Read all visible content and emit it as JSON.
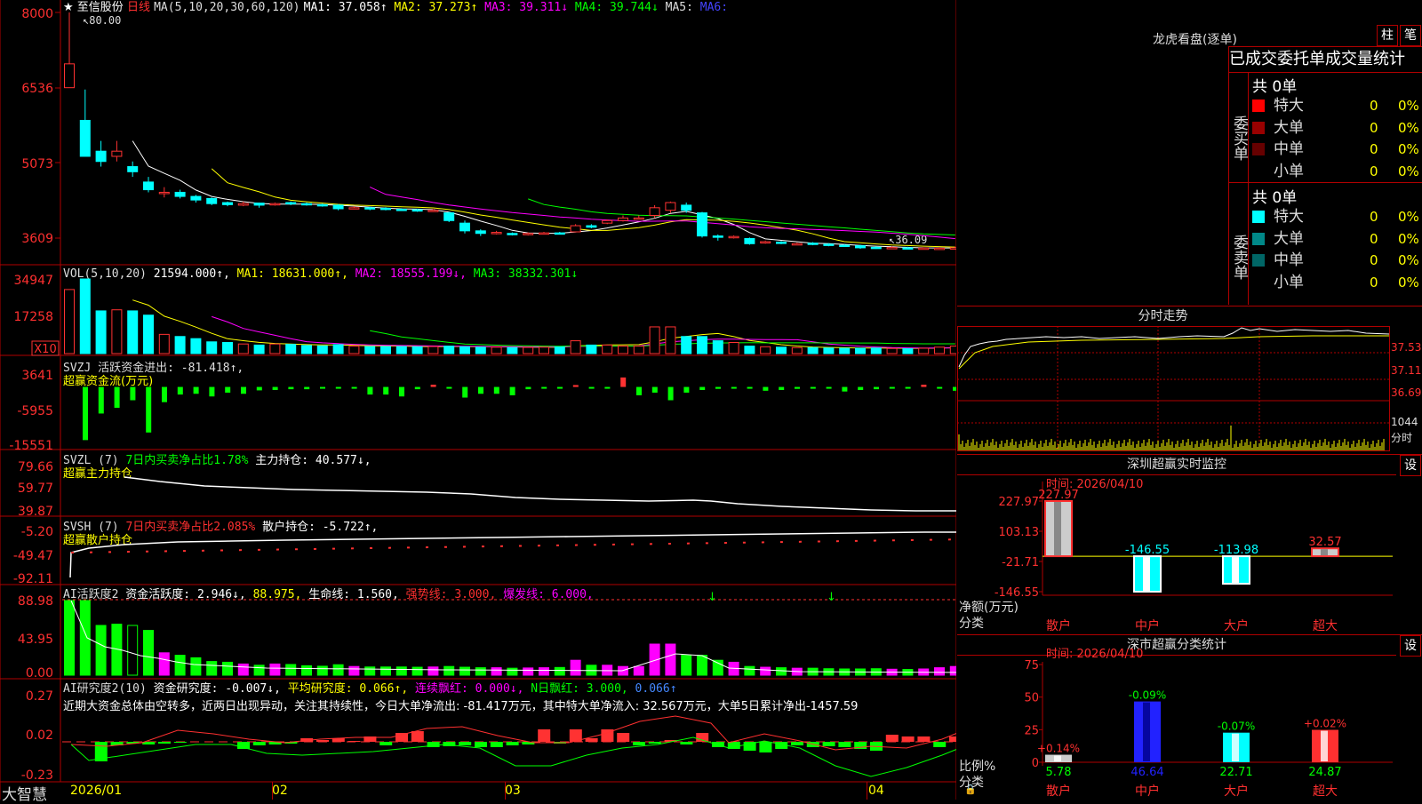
{
  "app_name": "大智慧",
  "stock": {
    "name": "至信股份",
    "period": "日线"
  },
  "ma_line": {
    "label": "MA(5,10,20,30,60,120)",
    "items": [
      {
        "text": "MA1: 37.058↑",
        "color": "#ffffff"
      },
      {
        "text": "MA2: 37.273↑",
        "color": "#ffff00"
      },
      {
        "text": "MA3: 39.311↓",
        "color": "#ff00ff"
      },
      {
        "text": "MA4: 39.744↓",
        "color": "#00ff00"
      },
      {
        "text": "MA5: ",
        "color": "#dddddd"
      },
      {
        "text": "MA6:",
        "color": "#4444ff"
      }
    ]
  },
  "price_axis": [
    "8000",
    "6536",
    "5073",
    "3609"
  ],
  "price_marks": {
    "high": "80.00",
    "low": "36.09"
  },
  "vol": {
    "axis": [
      "34947",
      "17258"
    ],
    "unit": "X10",
    "items": [
      {
        "text": "VOL(5,10,20)",
        "color": "#dddddd"
      },
      {
        "text": "21594.000↑,",
        "color": "#ffffff"
      },
      {
        "text": "MA1: 18631.000↑,",
        "color": "#ffff00"
      },
      {
        "text": "MA2: 18555.199↓,",
        "color": "#ff00ff"
      },
      {
        "text": "MA3: 38332.301↓",
        "color": "#00ff00"
      }
    ]
  },
  "svzj": {
    "axis": [
      "3641",
      "-5955",
      "-15551"
    ],
    "line1": "SVZJ  活跃资金进出: -81.418↑,",
    "line2": "超赢资金流(万元)"
  },
  "svzl": {
    "axis": [
      "79.66",
      "59.77",
      "39.87"
    ],
    "p1": "SVZL (7)",
    "p2": "7日内买卖净占比1.78%",
    "p3": "主力持仓: 40.577↓,",
    "line2": "超赢主力持仓"
  },
  "svsh": {
    "axis": [
      "-5.20",
      "-49.47",
      "-92.11"
    ],
    "p1": "SVSH (7)",
    "p2": "7日内买卖净占比2.085%",
    "p3": "散户持仓: -5.722↑,",
    "line2": "超赢散户持仓"
  },
  "ai1": {
    "axis": [
      "88.98",
      "43.95",
      "0.00"
    ],
    "items": [
      {
        "text": "AI活跃度2",
        "color": "#dddddd"
      },
      {
        "text": "资金活跃度: 2.946↓,",
        "color": "#ffffff"
      },
      {
        "text": "88.975,",
        "color": "#ffff00"
      },
      {
        "text": "生命线: 1.560,",
        "color": "#ffffff"
      },
      {
        "text": "强势线: 3.000,",
        "color": "#ff3030"
      },
      {
        "text": "爆发线: 6.000,",
        "color": "#ff00ff"
      }
    ]
  },
  "ai2": {
    "axis": [
      "0.27",
      "0.02",
      "-0.23"
    ],
    "items": [
      {
        "text": "AI研究度2(10)",
        "color": "#dddddd"
      },
      {
        "text": "资金研究度: -0.007↓,",
        "color": "#ffffff"
      },
      {
        "text": "平均研究度: 0.066↑,",
        "color": "#ffff00"
      },
      {
        "text": "连续飘红: 0.000↓,",
        "color": "#ff00ff"
      },
      {
        "text": "N日飘红: 3.000,",
        "color": "#00ff00"
      },
      {
        "text": "0.066↑",
        "color": "#4488ff"
      }
    ],
    "note": "近期大资金总体由空转多，近两日出现异动，关注其持续性，今日大单净流出: -81.417万元，其中特大单净流入: 32.567万元，大单5日累计净出-1457.59"
  },
  "date_axis": [
    "2026/01",
    "02",
    "03",
    "04"
  ],
  "right": {
    "lhkp_title": "龙虎看盘(逐单)",
    "btn_zhu": "柱",
    "btn_bi": "笔",
    "table_header": "已成交委托单成交量统计",
    "buy": {
      "side_label": "委买单",
      "total": "共 0单",
      "rows": [
        {
          "name": "特大",
          "count": "0",
          "pct": "0%",
          "color": "#ff0000"
        },
        {
          "name": "大单",
          "count": "0",
          "pct": "0%",
          "color": "#990000"
        },
        {
          "name": "中单",
          "count": "0",
          "pct": "0%",
          "color": "#660000"
        },
        {
          "name": "小单",
          "count": "0",
          "pct": "0%",
          "color": ""
        }
      ]
    },
    "sell": {
      "side_label": "委卖单",
      "total": "共 0单",
      "rows": [
        {
          "name": "特大",
          "count": "0",
          "pct": "0%",
          "color": "#00ffff"
        },
        {
          "name": "大单",
          "count": "0",
          "pct": "0%",
          "color": "#008888"
        },
        {
          "name": "中单",
          "count": "0",
          "pct": "0%",
          "color": "#006666"
        },
        {
          "name": "小单",
          "count": "0",
          "pct": "0%",
          "color": ""
        }
      ]
    },
    "fenshi": {
      "title": "分时走势",
      "axis": [
        "37.53",
        "37.11",
        "36.69"
      ],
      "vol_value": "1044",
      "vol_unit": "分时"
    },
    "monitor": {
      "title": "深圳超赢实时监控",
      "btn": "设",
      "time": "时间: 2026/04/10",
      "axis": [
        "227.97",
        "103.13",
        "-21.71",
        "-146.55"
      ],
      "ylabel": "净额(万元)",
      "xlabel": "分类",
      "bars": [
        {
          "cat": "散户",
          "label": "227.97",
          "value": 227.97
        },
        {
          "cat": "中户",
          "label": "-146.55",
          "value": -146.55
        },
        {
          "cat": "大户",
          "label": "-113.98",
          "value": -113.98
        },
        {
          "cat": "超大",
          "label": "32.57",
          "value": 32.57
        }
      ]
    },
    "stats": {
      "title": "深市超赢分类统计",
      "btn": "设",
      "time": "时间: 2026/04/10",
      "axis": [
        "75",
        "50",
        "25",
        "0"
      ],
      "ylabel": "比例%",
      "xlabel": "分类",
      "bars": [
        {
          "cat": "散户",
          "value": 5.78,
          "vlabel": "5.78",
          "chg": "+0.14%"
        },
        {
          "cat": "中户",
          "value": 46.64,
          "vlabel": "46.64",
          "chg": "-0.09%"
        },
        {
          "cat": "大户",
          "value": 22.71,
          "vlabel": "22.71",
          "chg": "-0.07%"
        },
        {
          "cat": "超大",
          "value": 24.87,
          "vlabel": "24.87",
          "chg": "+0.02%"
        }
      ]
    }
  },
  "colors": {
    "up": "#ff3232",
    "down": "#00ffff",
    "grid": "#b00000",
    "axis_text": "#ff3030"
  },
  "chart_data": [
    {
      "type": "candlestick",
      "title": "至信股份 日线",
      "ylim": [
        3609,
        8000
      ],
      "series": [
        {
          "name": "K线",
          "ohlc": [
            [
              6536,
              7000,
              8000,
              6536
            ],
            [
              5900,
              5200,
              6500,
              5200
            ],
            [
              5300,
              5100,
              5500,
              5000
            ],
            [
              5200,
              5300,
              5500,
              5100
            ],
            [
              5000,
              4900,
              5100,
              4800
            ],
            [
              4700,
              4550,
              4800,
              4500
            ],
            [
              4500,
              4500,
              4600,
              4400
            ],
            [
              4500,
              4420,
              4550,
              4380
            ],
            [
              4420,
              4350,
              4450,
              4300
            ],
            [
              4380,
              4280,
              4400,
              4250
            ],
            [
              4300,
              4260,
              4320,
              4230
            ],
            [
              4250,
              4280,
              4320,
              4230
            ],
            [
              4290,
              4250,
              4300,
              4200
            ],
            [
              4260,
              4280,
              4300,
              4240
            ],
            [
              4300,
              4280,
              4320,
              4250
            ],
            [
              4280,
              4260,
              4300,
              4240
            ],
            [
              4260,
              4240,
              4280,
              4220
            ],
            [
              4250,
              4180,
              4270,
              4150
            ],
            [
              4190,
              4200,
              4230,
              4170
            ],
            [
              4200,
              4180,
              4220,
              4150
            ],
            [
              4190,
              4170,
              4210,
              4150
            ],
            [
              4170,
              4160,
              4190,
              4140
            ],
            [
              4160,
              4150,
              4180,
              4120
            ],
            [
              4150,
              4150,
              4170,
              4120
            ],
            [
              4100,
              3950,
              4120,
              3920
            ],
            [
              3900,
              3750,
              3950,
              3700
            ],
            [
              3750,
              3700,
              3780,
              3650
            ],
            [
              3700,
              3720,
              3750,
              3680
            ],
            [
              3700,
              3680,
              3720,
              3660
            ],
            [
              3680,
              3700,
              3720,
              3660
            ],
            [
              3700,
              3710,
              3730,
              3680
            ],
            [
              3710,
              3700,
              3730,
              3690
            ],
            [
              3730,
              3850,
              3880,
              3720
            ],
            [
              3850,
              3820,
              3880,
              3800
            ],
            [
              3900,
              3950,
              3970,
              3880
            ],
            [
              3950,
              4000,
              4050,
              3930
            ],
            [
              4000,
              4000,
              4050,
              3980
            ],
            [
              4050,
              4200,
              4250,
              4000
            ],
            [
              4150,
              4300,
              4320,
              4100
            ],
            [
              4250,
              4150,
              4300,
              4100
            ],
            [
              4100,
              3650,
              4120,
              3620
            ],
            [
              3650,
              3640,
              3680,
              3560
            ],
            [
              3620,
              3640,
              3660,
              3600
            ],
            [
              3600,
              3500,
              3620,
              3480
            ],
            [
              3520,
              3540,
              3560,
              3500
            ],
            [
              3530,
              3510,
              3550,
              3490
            ],
            [
              3500,
              3500,
              3520,
              3480
            ],
            [
              3510,
              3490,
              3530,
              3470
            ],
            [
              3490,
              3470,
              3510,
              3450
            ],
            [
              3470,
              3460,
              3490,
              3440
            ],
            [
              3460,
              3420,
              3480,
              3400
            ],
            [
              3430,
              3420,
              3450,
              3400
            ],
            [
              3420,
              3425,
              3450,
              3410
            ],
            [
              3420,
              3410,
              3440,
              3400
            ],
            [
              3410,
              3415,
              3430,
              3400
            ],
            [
              3410,
              3412,
              3430,
              3400
            ],
            [
              3412,
              3420,
              3440,
              3400
            ]
          ]
        }
      ]
    },
    {
      "type": "bar",
      "title": "VOL(5,10,20)",
      "ylim": [
        0,
        34947
      ],
      "series": [
        {
          "name": "VOL",
          "values": [
            30000,
            34947,
            20000,
            20500,
            20000,
            18000,
            9000,
            8000,
            7000,
            5500,
            5200,
            4500,
            4000,
            4500,
            4300,
            3800,
            3600,
            4200,
            3500,
            3300,
            3300,
            3300,
            3200,
            3300,
            3500,
            3200,
            3000,
            3000,
            2800,
            2900,
            3000,
            3100,
            6000,
            4000,
            4000,
            3500,
            3500,
            12500,
            12500,
            8000,
            8000,
            6000,
            5200,
            3500,
            3200,
            3000,
            2800,
            2800,
            2600,
            2500,
            2500,
            2600,
            2400,
            2300,
            2500,
            3000,
            3500
          ]
        }
      ]
    },
    {
      "type": "bar",
      "title": "SVZJ",
      "ylim": [
        -15551,
        3641
      ],
      "series": [
        {
          "name": "活跃资金进出",
          "values": [
            -14000,
            -7000,
            -5500,
            -3500,
            -12000,
            -4000,
            -2000,
            -1800,
            -2500,
            -1500,
            -1800,
            -900,
            -800,
            -600,
            -600,
            -300,
            -200,
            -400,
            -2000,
            -2000,
            -2500,
            -600,
            600,
            -300,
            -2800,
            -1800,
            -1800,
            -2200,
            -600,
            -300,
            -300,
            500,
            -300,
            -300,
            2500,
            -2200,
            -1500,
            -3500,
            -1500,
            -800,
            -500,
            -300,
            -300,
            -1000,
            -800,
            -500,
            -400,
            -300,
            -1200,
            -800,
            -600,
            -400,
            -300,
            600,
            -400,
            -1000,
            -300
          ]
        }
      ]
    },
    {
      "type": "bar",
      "title": "深圳超赢实时监控",
      "categories": [
        "散户",
        "中户",
        "大户",
        "超大"
      ],
      "values": [
        227.97,
        -146.55,
        -113.98,
        32.57
      ],
      "ylabel": "净额(万元)",
      "xlabel": "分类",
      "ylim": [
        -146.55,
        227.97
      ]
    },
    {
      "type": "bar",
      "title": "深市超赢分类统计",
      "categories": [
        "散户",
        "中户",
        "大户",
        "超大"
      ],
      "values": [
        5.78,
        46.64,
        22.71,
        24.87
      ],
      "ylabel": "比例%",
      "xlabel": "分类",
      "ylim": [
        0,
        75
      ]
    }
  ]
}
